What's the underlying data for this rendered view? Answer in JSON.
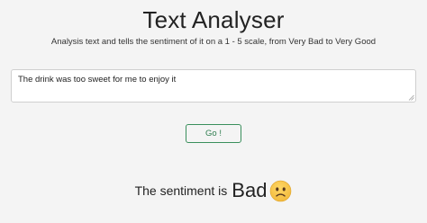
{
  "header": {
    "title": "Text Analyser",
    "subtitle": "Analysis text and tells the sentiment of it on a 1 - 5 scale, from Very Bad to Very Good"
  },
  "input": {
    "value": "The drink was too sweet for me to enjoy it"
  },
  "action": {
    "go_label": "Go !"
  },
  "result": {
    "prefix": "The sentiment is",
    "value": "Bad",
    "emoji_icon": "slightly-frowning-face-icon"
  },
  "colors": {
    "background": "#f4f4f4",
    "button_border": "#3a8f5c",
    "button_text": "#2f7d4f",
    "emoji_face": "#f5c44e"
  }
}
